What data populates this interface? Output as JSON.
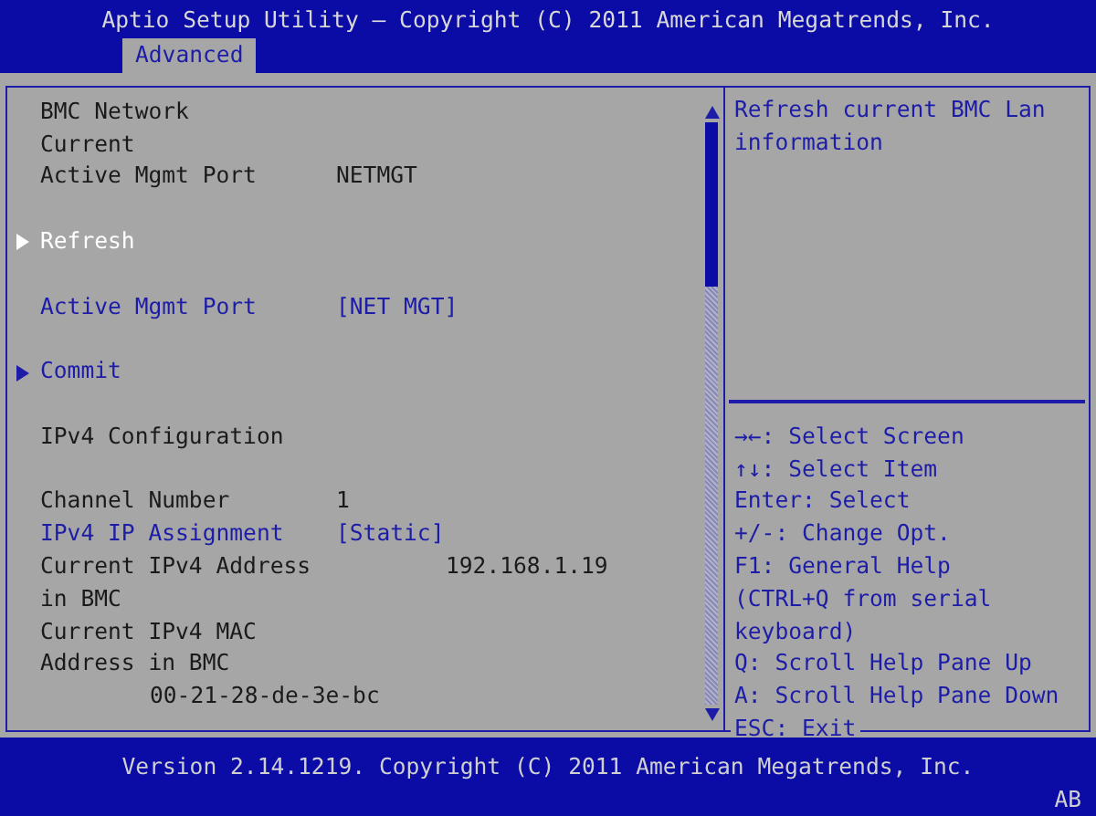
{
  "window": {
    "title": "Aptio Setup Utility – Copyright (C) 2011 American Megatrends, Inc."
  },
  "tabs": [
    {
      "label": "Advanced",
      "selected": true
    }
  ],
  "settings": {
    "sections": [
      [
        {
          "kind": "static",
          "label": "BMC Network"
        },
        {
          "kind": "static",
          "label": "Current"
        },
        {
          "kind": "static",
          "label": "Active Mgmt Port",
          "value": "NETMGT"
        }
      ],
      [
        {
          "kind": "submenu",
          "label": "Refresh",
          "selected": true
        }
      ],
      [
        {
          "kind": "option",
          "label": "Active Mgmt Port",
          "value": "[NET MGT]"
        }
      ],
      [
        {
          "kind": "submenu",
          "label": "Commit",
          "selected": false
        }
      ],
      [
        {
          "kind": "static",
          "label": "IPv4 Configuration"
        }
      ],
      [
        {
          "kind": "static",
          "label": "Channel Number",
          "value": "1"
        },
        {
          "kind": "option",
          "label": "IPv4 IP Assignment",
          "value": "[Static]"
        },
        {
          "kind": "address",
          "label": "Current IPv4 Address in BMC",
          "value": "192.168.1.19"
        },
        {
          "kind": "below",
          "label": "Current IPv4 MAC Address in BMC",
          "value": "00-21-28-de-3e-bc"
        }
      ]
    ]
  },
  "help": {
    "description": "Refresh current BMC Lan information",
    "keys": [
      "→←: Select Screen",
      "↑↓: Select Item",
      "Enter: Select",
      "+/-: Change Opt.",
      "F1: General Help",
      "(CTRL+Q from serial keyboard)",
      "Q: Scroll Help Pane Up",
      "A: Scroll Help Pane Down"
    ],
    "exit": "ESC: Exit"
  },
  "footer": {
    "version": "Version 2.14.1219. Copyright (C) 2011 American Megatrends, Inc.",
    "indicator": "AB"
  }
}
